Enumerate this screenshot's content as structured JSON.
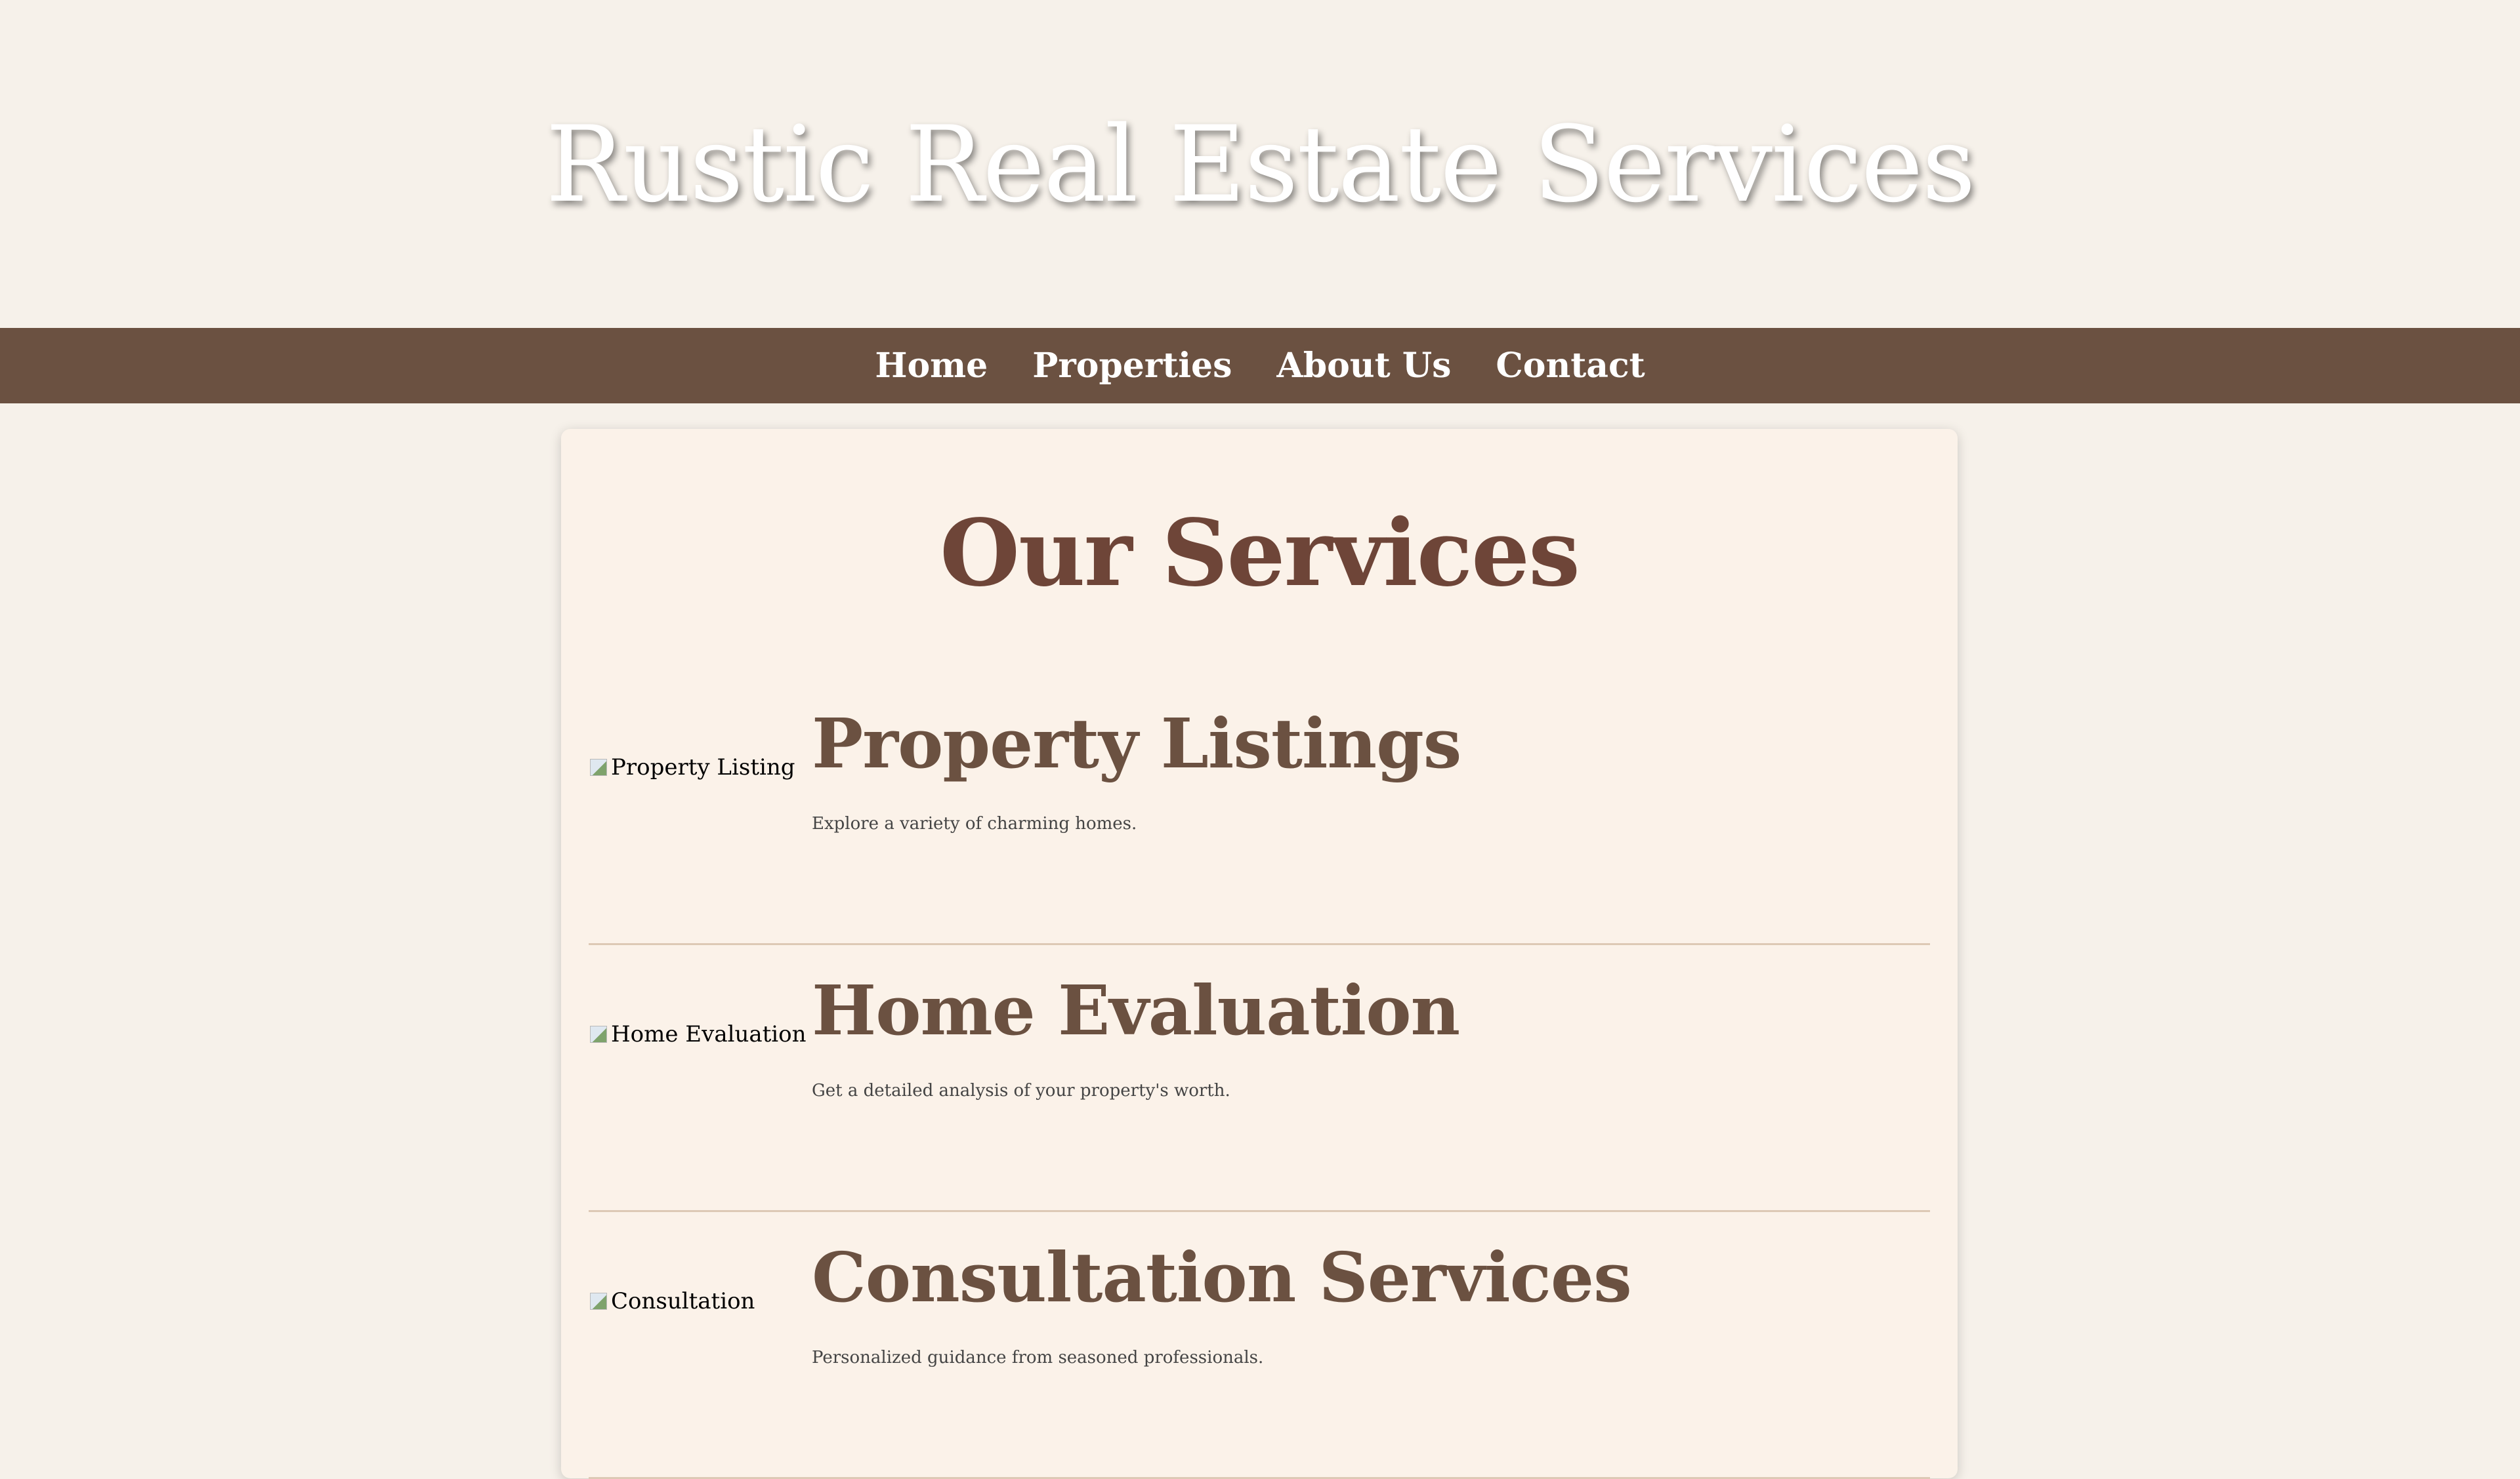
{
  "header": {
    "title": "Rustic Real Estate Services"
  },
  "nav": {
    "items": [
      {
        "label": "Home"
      },
      {
        "label": "Properties"
      },
      {
        "label": "About Us"
      },
      {
        "label": "Contact"
      }
    ]
  },
  "main": {
    "title": "Our Services",
    "services": [
      {
        "image_alt": "Property Listing",
        "heading": "Property Listings",
        "description": "Explore a variety of charming homes."
      },
      {
        "image_alt": "Home Evaluation",
        "heading": "Home Evaluation",
        "description": "Get a detailed analysis of your property's worth."
      },
      {
        "image_alt": "Consultation",
        "heading": "Consultation Services",
        "description": "Personalized guidance from seasoned professionals."
      }
    ]
  },
  "colors": {
    "page_background": "#f6f1ea",
    "nav_background": "#6b5141",
    "card_background": "#fbf2e9",
    "section_title": "#6e4538",
    "service_heading": "#6b5141",
    "divider": "#ddc9b5"
  },
  "icons": {
    "service_image": "broken-image-icon"
  }
}
